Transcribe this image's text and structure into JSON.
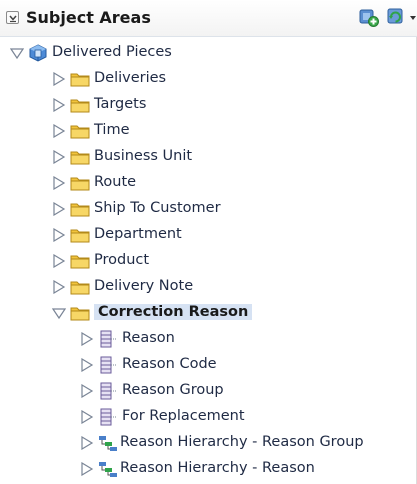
{
  "panel": {
    "title": "Subject Areas",
    "add_icon": "add-subject-area-icon",
    "refresh_icon": "refresh-icon"
  },
  "tree": {
    "root": {
      "label": "Delivered Pieces",
      "icon": "cube-icon",
      "expanded": true
    },
    "folders": [
      {
        "label": "Deliveries"
      },
      {
        "label": "Targets"
      },
      {
        "label": "Time"
      },
      {
        "label": "Business Unit"
      },
      {
        "label": "Route"
      },
      {
        "label": "Ship To Customer"
      },
      {
        "label": "Department"
      },
      {
        "label": "Product"
      },
      {
        "label": "Delivery Note"
      },
      {
        "label": "Correction Reason",
        "expanded": true,
        "selected": true
      }
    ],
    "columns": [
      {
        "label": "Reason",
        "icon": "column-icon"
      },
      {
        "label": "Reason Code",
        "icon": "column-icon"
      },
      {
        "label": "Reason Group",
        "icon": "column-icon"
      },
      {
        "label": "For Replacement",
        "icon": "column-icon"
      },
      {
        "label": "Reason Hierarchy - Reason Group",
        "icon": "hierarchy-icon"
      },
      {
        "label": "Reason Hierarchy - Reason",
        "icon": "hierarchy-icon"
      }
    ]
  },
  "colors": {
    "folder": "#f2c43c",
    "cube": "#3a78c4",
    "selection": "#d6e2f3",
    "text": "#1f2a44"
  }
}
